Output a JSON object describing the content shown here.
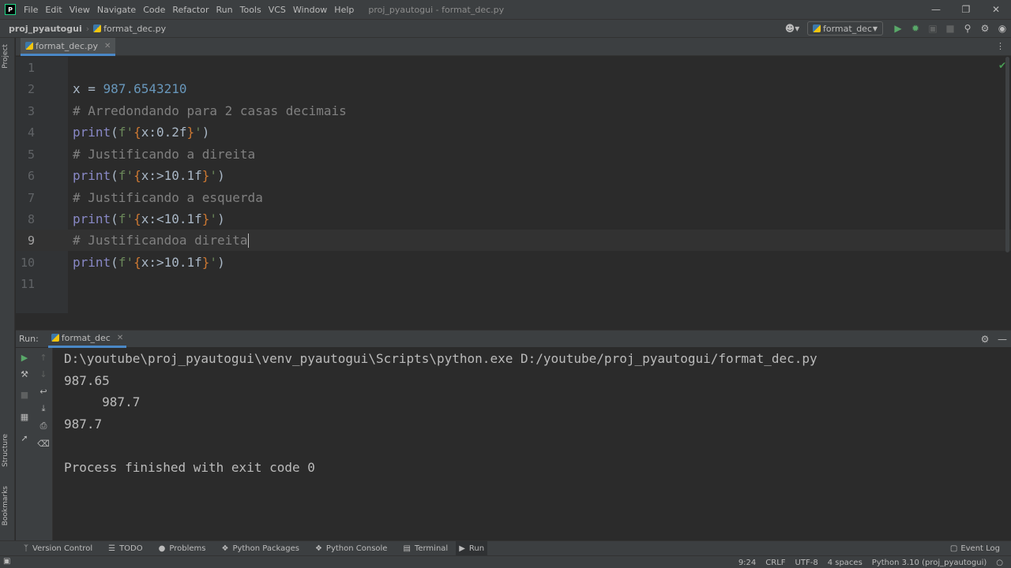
{
  "menubar": {
    "items": [
      "File",
      "Edit",
      "View",
      "Navigate",
      "Code",
      "Refactor",
      "Run",
      "Tools",
      "VCS",
      "Window",
      "Help"
    ],
    "window_title": "proj_pyautogui - format_dec.py"
  },
  "navbar": {
    "project": "proj_pyautogui",
    "file": "format_dec.py",
    "run_config": "format_dec"
  },
  "left_strip": {
    "project_label": "Project",
    "structure_label": "Structure",
    "bookmarks_label": "Bookmarks"
  },
  "editor": {
    "tab_label": "format_dec.py",
    "current_line": 9,
    "lines": [
      {
        "n": "1"
      },
      {
        "n": "2"
      },
      {
        "n": "3"
      },
      {
        "n": "4"
      },
      {
        "n": "5"
      },
      {
        "n": "6"
      },
      {
        "n": "7"
      },
      {
        "n": "8"
      },
      {
        "n": "9"
      },
      {
        "n": "10"
      },
      {
        "n": "11"
      }
    ],
    "code": {
      "l2_var": "x = ",
      "l2_num": "987.6543210",
      "l3": "# Arredondando para 2 casas decimais",
      "l4_fmt": "x:0.2f",
      "l5": "# Justificando a direita",
      "l6_fmt": "x:>10.1f",
      "l7": "# Justificando a esquerda",
      "l8_fmt": "x:<10.1f",
      "l9": "# Justificandoa direita",
      "l10_fmt": "x:>10.1f",
      "print": "print",
      "fprefix": "f'",
      "quote_close": "'",
      "paren_open": "(",
      "paren_close": ")",
      "brace_open": "{",
      "brace_close": "}"
    }
  },
  "run_panel": {
    "label": "Run:",
    "tab": "format_dec"
  },
  "console": {
    "lines": [
      "D:\\youtube\\proj_pyautogui\\venv_pyautogui\\Scripts\\python.exe D:/youtube/proj_pyautogui/format_dec.py",
      "987.65",
      "     987.7",
      "987.7",
      "",
      "Process finished with exit code 0"
    ]
  },
  "bottom_bar": {
    "items": [
      "Version Control",
      "TODO",
      "Problems",
      "Python Packages",
      "Python Console",
      "Terminal",
      "Run"
    ],
    "event_log": "Event Log"
  },
  "status_bar": {
    "position": "9:24",
    "line_sep": "CRLF",
    "encoding": "UTF-8",
    "indent": "4 spaces",
    "interpreter": "Python 3.10 (proj_pyautogui)"
  },
  "colors": {
    "accent": "#4a88c7",
    "run_green": "#59a869",
    "background": "#2b2b2b"
  }
}
